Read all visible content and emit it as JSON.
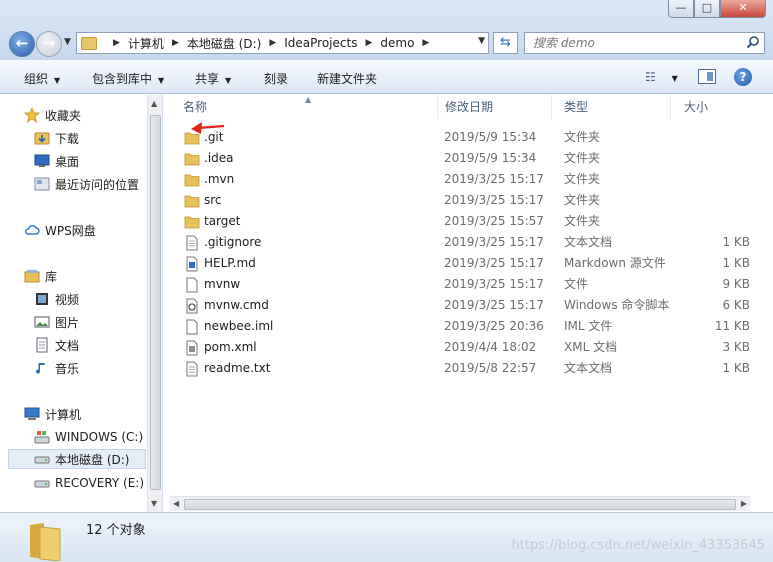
{
  "window": {
    "min_glyph": "—",
    "max_glyph": "□",
    "close_glyph": "✕"
  },
  "address": {
    "crumbs": [
      "计算机",
      "本地磁盘 (D:)",
      "IdeaProjects",
      "demo"
    ]
  },
  "search": {
    "placeholder": "搜索 demo"
  },
  "toolbar": {
    "organize": "组织",
    "include_in_library": "包含到库中",
    "share": "共享",
    "burn": "刻录",
    "new_folder": "新建文件夹",
    "help": "?"
  },
  "navpane": {
    "favorites": "收藏夹",
    "downloads": "下载",
    "desktop": "桌面",
    "recent": "最近访问的位置",
    "wps": "WPS网盘",
    "libraries": "库",
    "videos": "视频",
    "pictures": "图片",
    "documents": "文档",
    "music": "音乐",
    "computer": "计算机",
    "drive_c": "WINDOWS (C:)",
    "drive_d": "本地磁盘 (D:)",
    "drive_e": "RECOVERY (E:)"
  },
  "columns": {
    "name": "名称",
    "date": "修改日期",
    "type": "类型",
    "size": "大小"
  },
  "files": [
    {
      "name": ".git",
      "date": "2019/5/9 15:34",
      "type": "文件夹",
      "size": "",
      "icon": "folder-icon"
    },
    {
      "name": ".idea",
      "date": "2019/5/9 15:34",
      "type": "文件夹",
      "size": "",
      "icon": "folder-icon"
    },
    {
      "name": ".mvn",
      "date": "2019/3/25 15:17",
      "type": "文件夹",
      "size": "",
      "icon": "folder-icon"
    },
    {
      "name": "src",
      "date": "2019/3/25 15:17",
      "type": "文件夹",
      "size": "",
      "icon": "folder-icon"
    },
    {
      "name": "target",
      "date": "2019/3/25 15:57",
      "type": "文件夹",
      "size": "",
      "icon": "folder-icon"
    },
    {
      "name": ".gitignore",
      "date": "2019/3/25 15:17",
      "type": "文本文档",
      "size": "1 KB",
      "icon": "text-file-icon"
    },
    {
      "name": "HELP.md",
      "date": "2019/3/25 15:17",
      "type": "Markdown 源文件",
      "size": "1 KB",
      "icon": "markdown-file-icon"
    },
    {
      "name": "mvnw",
      "date": "2019/3/25 15:17",
      "type": "文件",
      "size": "9 KB",
      "icon": "blank-file-icon"
    },
    {
      "name": "mvnw.cmd",
      "date": "2019/3/25 15:17",
      "type": "Windows 命令脚本",
      "size": "6 KB",
      "icon": "cmd-script-icon"
    },
    {
      "name": "newbee.iml",
      "date": "2019/3/25 20:36",
      "type": "IML 文件",
      "size": "11 KB",
      "icon": "blank-file-icon"
    },
    {
      "name": "pom.xml",
      "date": "2019/4/4 18:02",
      "type": "XML 文档",
      "size": "3 KB",
      "icon": "xml-file-icon"
    },
    {
      "name": "readme.txt",
      "date": "2019/5/8 22:57",
      "type": "文本文档",
      "size": "1 KB",
      "icon": "text-file-icon"
    }
  ],
  "status": {
    "count": "12 个对象"
  },
  "watermark": "https://blog.csdn.net/weixin_43353645",
  "colors": {
    "folder": "#e9c15a",
    "accent": "#2a5fa8",
    "annotation_arrow": "#e0241b"
  }
}
